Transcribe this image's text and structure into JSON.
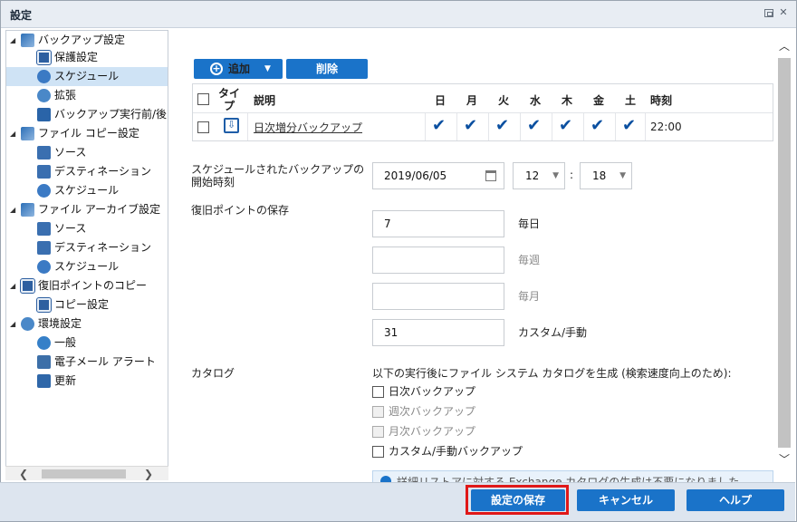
{
  "window": {
    "title": "設定"
  },
  "sidebar": {
    "items": [
      {
        "label": "バックアップ設定",
        "icon": "backup-settings-icon"
      },
      {
        "label": "保護設定",
        "icon": "document-icon"
      },
      {
        "label": "スケジュール",
        "icon": "clock-icon",
        "selected": true
      },
      {
        "label": "拡張",
        "icon": "gear-icon"
      },
      {
        "label": "バックアップ実行前/後の設定",
        "icon": "wrench-icon"
      },
      {
        "label": "ファイル コピー設定",
        "icon": "file-copy-icon"
      },
      {
        "label": "ソース",
        "icon": "network-icon"
      },
      {
        "label": "デスティネーション",
        "icon": "network-icon"
      },
      {
        "label": "スケジュール",
        "icon": "clock-icon"
      },
      {
        "label": "ファイル アーカイブ設定",
        "icon": "file-archive-icon"
      },
      {
        "label": "ソース",
        "icon": "network-icon"
      },
      {
        "label": "デスティネーション",
        "icon": "network-icon"
      },
      {
        "label": "スケジュール",
        "icon": "clock-icon"
      },
      {
        "label": "復旧ポイントのコピー",
        "icon": "document-icon"
      },
      {
        "label": "コピー設定",
        "icon": "document-icon"
      },
      {
        "label": "環境設定",
        "icon": "gear-icon"
      },
      {
        "label": "一般",
        "icon": "globe-icon"
      },
      {
        "label": "電子メール アラート",
        "icon": "mail-icon"
      },
      {
        "label": "更新",
        "icon": "update-icon"
      }
    ]
  },
  "toolbar": {
    "add_label": "追加",
    "delete_label": "削除"
  },
  "schedule_grid": {
    "headers": {
      "type": "タイプ",
      "description": "説明",
      "days": [
        "日",
        "月",
        "火",
        "水",
        "木",
        "金",
        "土"
      ],
      "time": "時刻"
    },
    "rows": [
      {
        "description": "日次増分バックアップ",
        "days_checked": [
          true,
          true,
          true,
          true,
          true,
          true,
          true
        ],
        "time": "22:00"
      }
    ]
  },
  "start_time": {
    "label": "スケジュールされたバックアップの開始時刻",
    "date": "2019/06/05",
    "hour": "12",
    "separator": ":",
    "minute": "18"
  },
  "retention": {
    "label": "復旧ポイントの保存",
    "rows": [
      {
        "value": "7",
        "unit": "毎日",
        "enabled": true
      },
      {
        "value": "",
        "unit": "毎週",
        "enabled": false
      },
      {
        "value": "",
        "unit": "毎月",
        "enabled": false
      },
      {
        "value": "31",
        "unit": "カスタム/手動",
        "enabled": true
      }
    ]
  },
  "catalog": {
    "label": "カタログ",
    "description": "以下の実行後にファイル システム カタログを生成 (検索速度向上のため):",
    "options": [
      {
        "label": "日次バックアップ",
        "enabled": true,
        "checked": false
      },
      {
        "label": "週次バックアップ",
        "enabled": false,
        "checked": false
      },
      {
        "label": "月次バックアップ",
        "enabled": false,
        "checked": false
      },
      {
        "label": "カスタム/手動バックアップ",
        "enabled": true,
        "checked": false
      }
    ],
    "info_text": "詳細リストアに対する Exchange カタログの生成は不要になりました。"
  },
  "footer": {
    "save_label": "設定の保存",
    "cancel_label": "キャンセル",
    "help_label": "ヘルプ"
  },
  "colors": {
    "accent": "#1a73c9",
    "selection": "#cfe3f5",
    "highlight_border": "#e01818"
  }
}
